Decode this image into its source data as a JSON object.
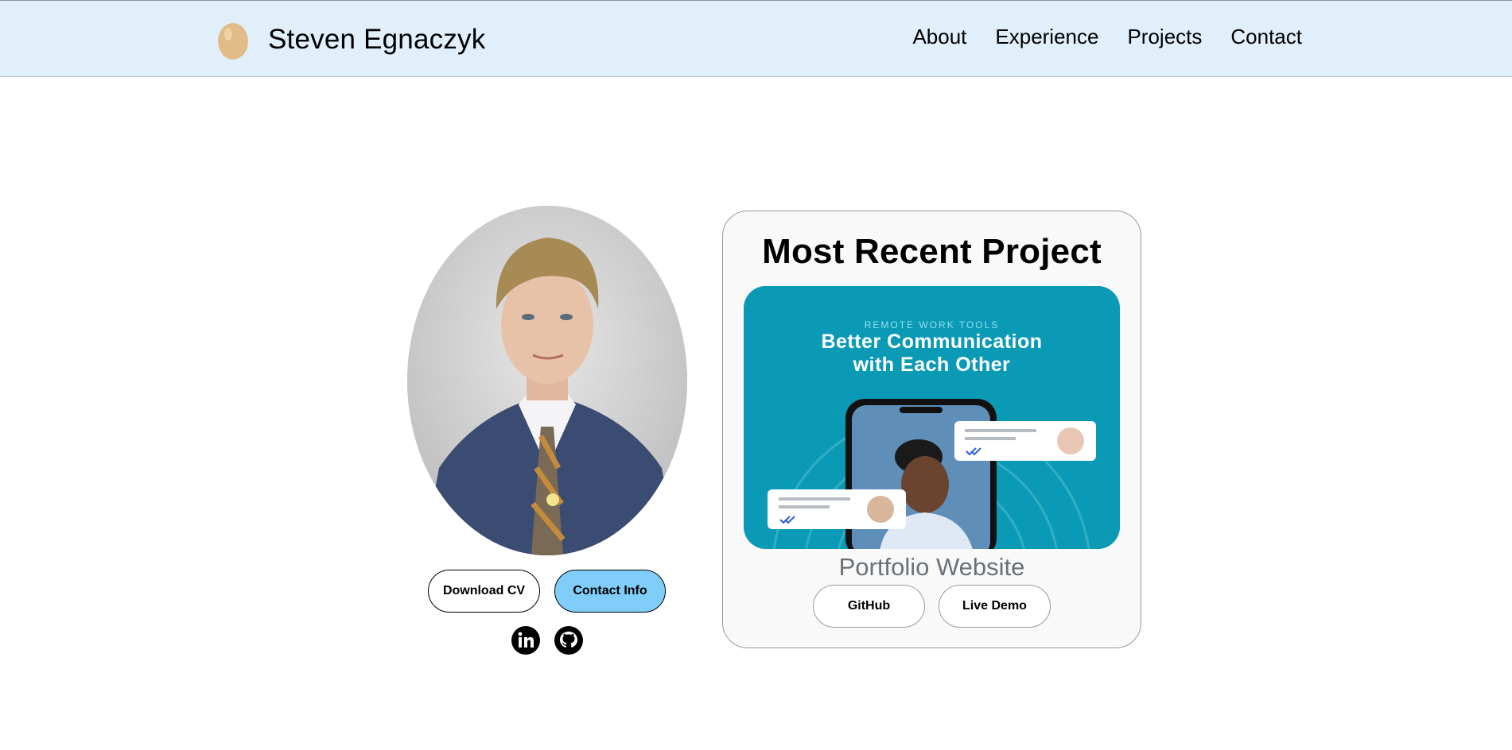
{
  "header": {
    "name": "Steven Egnaczyk",
    "nav": [
      "About",
      "Experience",
      "Projects",
      "Contact"
    ]
  },
  "profile": {
    "buttons": {
      "download_cv": "Download CV",
      "contact_info": "Contact Info"
    },
    "social_icons": [
      "linkedin-icon",
      "github-icon"
    ]
  },
  "project": {
    "heading": "Most Recent Project",
    "image": {
      "kicker": "REMOTE WORK TOOLS",
      "headline_line1": "Better Communication",
      "headline_line2": "with Each Other"
    },
    "name": "Portfolio Website",
    "buttons": {
      "github": "GitHub",
      "live_demo": "Live Demo"
    }
  },
  "colors": {
    "header_bg": "#e1effb",
    "contact_button": "#7fcdf8",
    "project_image_bg": "#0b9ab6"
  }
}
